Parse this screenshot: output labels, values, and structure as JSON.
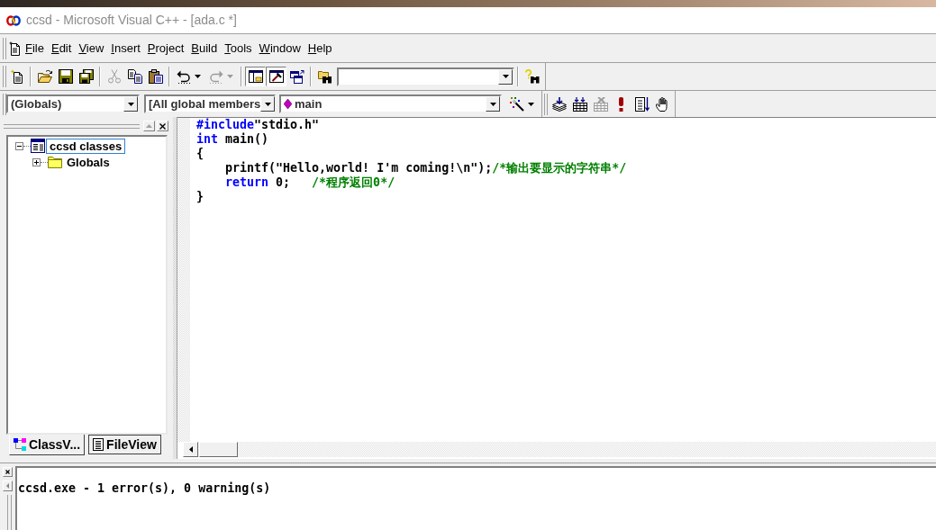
{
  "title_bar": {
    "title": "ccsd - Microsoft Visual C++ - [ada.c *]",
    "active": false
  },
  "menu_bar": {
    "items": [
      "File",
      "Edit",
      "View",
      "Insert",
      "Project",
      "Build",
      "Tools",
      "Window",
      "Help"
    ]
  },
  "standard_toolbar": {
    "groups": [
      [
        {
          "kind": "button",
          "disabled": false,
          "pressed": false
        }
      ],
      [
        {
          "kind": "button",
          "disabled": false,
          "pressed": false
        },
        {
          "kind": "button",
          "disabled": false,
          "pressed": false
        },
        {
          "kind": "button",
          "disabled": false,
          "pressed": false
        }
      ],
      [
        {
          "kind": "button",
          "disabled": true,
          "pressed": false
        },
        {
          "kind": "button",
          "disabled": false,
          "pressed": false
        },
        {
          "kind": "button",
          "disabled": false,
          "pressed": false
        }
      ],
      [
        {
          "kind": "split",
          "disabled": false,
          "pressed": false
        },
        {
          "kind": "split",
          "disabled": true,
          "pressed": false
        }
      ],
      [
        {
          "kind": "button",
          "disabled": false,
          "pressed": true
        },
        {
          "kind": "button",
          "disabled": false,
          "pressed": true
        },
        {
          "kind": "button",
          "disabled": false,
          "pressed": false
        }
      ],
      [
        {
          "kind": "button",
          "disabled": false,
          "pressed": false
        },
        {
          "kind": "combo"
        }
      ],
      [
        {
          "kind": "button",
          "disabled": false,
          "pressed": false
        }
      ]
    ]
  },
  "wizard_bar": {
    "combos": [
      {
        "kind": "plain",
        "value": "(Globals)"
      },
      {
        "kind": "plain",
        "value": "[All global members"
      },
      {
        "kind": "function",
        "value": "main"
      }
    ],
    "actions": [
      {
        "kind": "split",
        "disabled": false,
        "pressed": false
      }
    ]
  },
  "build_toolbar": {
    "buttons": [
      {
        "kind": "button",
        "disabled": false,
        "pressed": false
      },
      {
        "kind": "button",
        "disabled": false,
        "pressed": false
      },
      {
        "kind": "button",
        "disabled": true,
        "pressed": false
      },
      {
        "kind": "button",
        "disabled": false,
        "pressed": false
      },
      {
        "kind": "button",
        "disabled": false,
        "pressed": false
      },
      {
        "kind": "button",
        "disabled": false,
        "pressed": false
      }
    ]
  },
  "workspace": {
    "tree": [
      {
        "kind": "project",
        "label": "ccsd classes",
        "expanded": true,
        "selected": true,
        "children": [
          {
            "kind": "folder",
            "label": "Globals",
            "expanded": false,
            "selected": false
          }
        ]
      }
    ],
    "tabs": [
      {
        "kind": "class_view",
        "label": "ClassV...",
        "selected": true
      },
      {
        "kind": "file_view",
        "label": "FileView",
        "selected": false
      }
    ]
  },
  "editor": {
    "lines": [
      {
        "tokens": [
          {
            "kind": "keyword",
            "text": "#include"
          },
          {
            "kind": "text",
            "text": "\"stdio.h\""
          }
        ]
      },
      {
        "tokens": [
          {
            "kind": "keyword",
            "text": "int"
          },
          {
            "kind": "text",
            "text": " main()"
          }
        ]
      },
      {
        "tokens": [
          {
            "kind": "text",
            "text": "{"
          }
        ]
      },
      {
        "tokens": [
          {
            "kind": "text",
            "text": "    printf(\"Hello,world! I'm coming!\\n\");"
          },
          {
            "kind": "comment",
            "text": "/*输出要显示的字符串*/"
          }
        ]
      },
      {
        "tokens": [
          {
            "kind": "keyword",
            "text": "    return"
          },
          {
            "kind": "text",
            "text": " 0;   "
          },
          {
            "kind": "comment",
            "text": "/*程序返回0*/"
          }
        ]
      },
      {
        "tokens": [
          {
            "kind": "text",
            "text": "}"
          }
        ]
      }
    ]
  },
  "output": {
    "lines": [
      "ccsd.exe - 1 error(s), 0 warning(s)"
    ]
  }
}
